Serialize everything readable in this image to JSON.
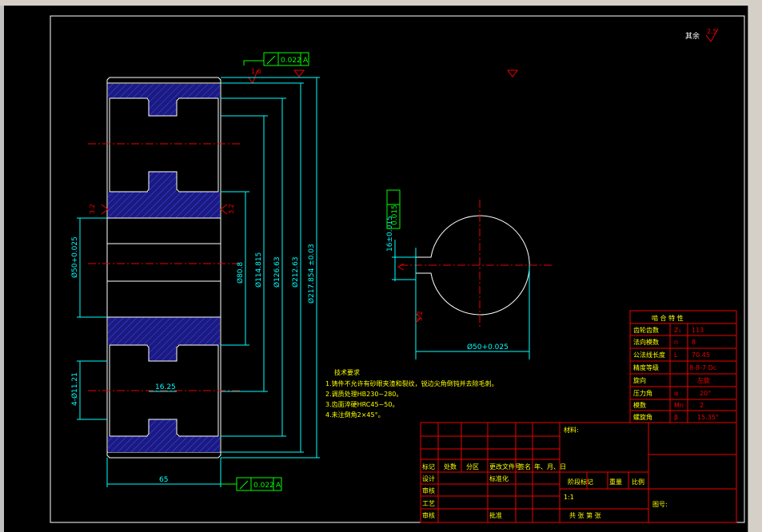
{
  "roughness": {
    "general": "其余",
    "general_value": "2.5",
    "r1": "1.6",
    "r2": "3.2",
    "r3": "3.2",
    "r4": "3.2",
    "r5": "3.2"
  },
  "dims": {
    "tol_top": "0.022",
    "tol_top_datum": "A",
    "tol_bottom": "0.022",
    "tol_bottom_datum": "A",
    "d1": "Ø50+0.025",
    "d2": "Ø80.8",
    "d3": "Ø114.815",
    "d4": "Ø126.63",
    "d5": "Ø212.63",
    "d6": "Ø217.854 ±0.03",
    "holes": "4-Ø11.21",
    "web": "16.25",
    "width": "65",
    "key_tol": "0.015",
    "key_dim": "16±0.015",
    "bore": "Ø50+0.025"
  },
  "notes": {
    "title": "技术要求",
    "items": [
      "1.铸件不允许有砂眼夹渣和裂纹，锐边尖角倒钝并去除毛刺。",
      "2.调质处理HB230~280。",
      "3.齿面淬硬HRC45~50。",
      "4.未注倒角2×45°。"
    ]
  },
  "params": {
    "title": "啮 合 特 性",
    "rows": [
      {
        "name": "齿轮齿数",
        "sym": "Z₁",
        "val": "113"
      },
      {
        "name": "法向模数",
        "sym": "n",
        "val": "8"
      },
      {
        "name": "公法线长度",
        "sym": "L",
        "val": "70.45"
      },
      {
        "name": "精度等级",
        "sym": "",
        "val": "8-8-7 Dc"
      },
      {
        "name": "旋向",
        "sym": "",
        "val": "左旋"
      },
      {
        "name": "压力角",
        "sym": "α",
        "val": "20°"
      },
      {
        "name": "模数",
        "sym": "Mn",
        "val": "2"
      },
      {
        "name": "螺旋角",
        "sym": "β",
        "val": "15.35°"
      }
    ]
  },
  "titleblock": {
    "material": "材料:",
    "h1": "标记",
    "h2": "处数",
    "h3": "分区",
    "h4": "更改文件号",
    "h5": "签名",
    "h6": "年、月、日",
    "r_design": "设计",
    "r_std": "标准化",
    "r_check": "审核",
    "r_process": "工艺",
    "r_approve": "批准",
    "stage": "阶段标记",
    "weight": "重量",
    "scale_label": "比例",
    "scale": "1:1",
    "sheets": "共 张 第 张",
    "drawno": "图号:"
  }
}
